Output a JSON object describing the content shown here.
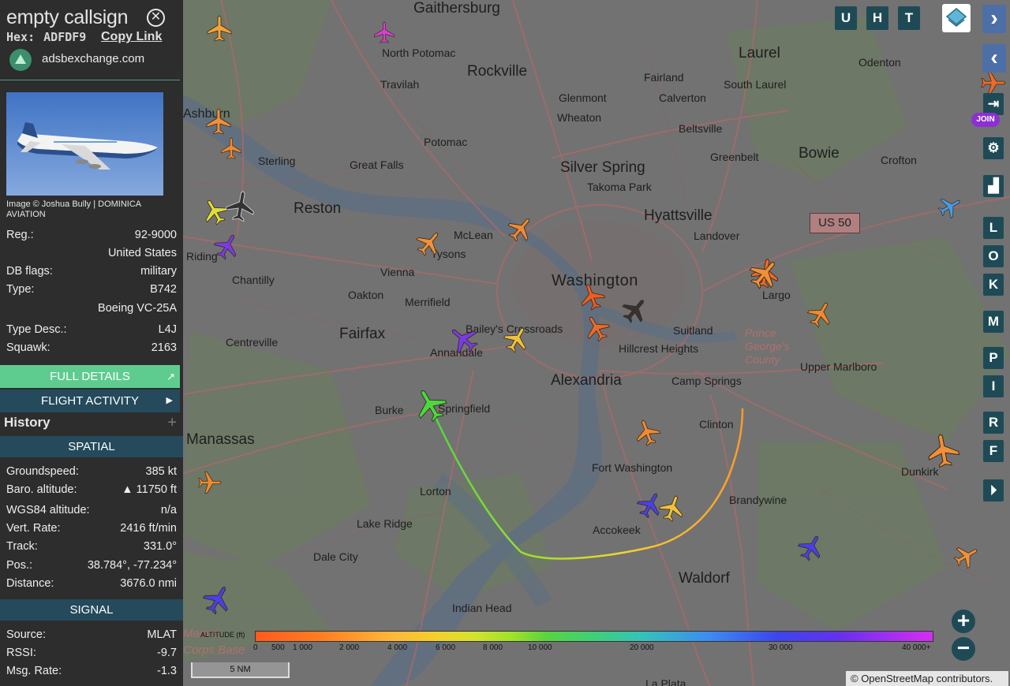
{
  "sidebar": {
    "callsign": "empty callsign",
    "hex_label": "Hex:",
    "hex": "ADFDF9",
    "copy_link": "Copy Link",
    "site": "adsbexchange.com",
    "photo_credit": "Image © Joshua Bully | DOMINICA AVIATION",
    "details": [
      {
        "k": "Reg.:",
        "v": "92-9000"
      },
      {
        "k": "",
        "v": "United States"
      },
      {
        "k": "DB flags:",
        "v": "military"
      },
      {
        "k": "Type:",
        "v": "B742"
      },
      {
        "k": "",
        "v": "Boeing VC-25A"
      },
      {
        "k": "Type Desc.:",
        "v": "L4J"
      },
      {
        "k": "Squawk:",
        "v": "2163"
      }
    ],
    "full_details": "FULL DETAILS",
    "flight_activity": "FLIGHT ACTIVITY",
    "history": "History",
    "spatial_title": "SPATIAL",
    "spatial": [
      {
        "k": "Groundspeed:",
        "v": "385 kt"
      },
      {
        "k": "Baro. altitude:",
        "v": "▲ 11750 ft"
      },
      {
        "k": "WGS84 altitude:",
        "v": "n/a"
      },
      {
        "k": "Vert. Rate:",
        "v": "2416 ft/min"
      },
      {
        "k": "Track:",
        "v": "331.0°"
      },
      {
        "k": "Pos.:",
        "v": "38.784°, -77.234°"
      },
      {
        "k": "Distance:",
        "v": "3676.0 nmi"
      }
    ],
    "signal_title": "SIGNAL",
    "signal": [
      {
        "k": "Source:",
        "v": "MLAT"
      },
      {
        "k": "RSSI:",
        "v": "-9.7"
      },
      {
        "k": "Msg. Rate:",
        "v": "-1.3"
      }
    ]
  },
  "map": {
    "labels": [
      {
        "t": "Gaithersburg",
        "c": "lbl big"
      },
      {
        "t": "North Potomac",
        "c": "lbl sm"
      },
      {
        "t": "Rockville",
        "c": "lbl big"
      },
      {
        "t": "Travilah",
        "c": "lbl sm"
      },
      {
        "t": "Laurel",
        "c": "lbl big"
      },
      {
        "t": "Odenton",
        "c": "lbl sm"
      },
      {
        "t": "Fairland",
        "c": "lbl sm"
      },
      {
        "t": "South Laurel",
        "c": "lbl sm"
      },
      {
        "t": "Glenmont",
        "c": "lbl sm"
      },
      {
        "t": "Calverton",
        "c": "lbl sm"
      },
      {
        "t": "Wheaton",
        "c": "lbl sm"
      },
      {
        "t": "Ashburn",
        "c": "lbl"
      },
      {
        "t": "Beltsville",
        "c": "lbl sm"
      },
      {
        "t": "Potomac",
        "c": "lbl sm"
      },
      {
        "t": "Sterling",
        "c": "lbl sm"
      },
      {
        "t": "Great Falls",
        "c": "lbl sm"
      },
      {
        "t": "Silver Spring",
        "c": "lbl big"
      },
      {
        "t": "Greenbelt",
        "c": "lbl sm"
      },
      {
        "t": "Bowie",
        "c": "lbl big"
      },
      {
        "t": "Crofton",
        "c": "lbl sm"
      },
      {
        "t": "Takoma Park",
        "c": "lbl sm"
      },
      {
        "t": "Reston",
        "c": "lbl big"
      },
      {
        "t": "Hyattsville",
        "c": "lbl big"
      },
      {
        "t": "McLean",
        "c": "lbl sm"
      },
      {
        "t": "Landover",
        "c": "lbl sm"
      },
      {
        "t": "Tysons",
        "c": "lbl sm"
      },
      {
        "t": "Riding",
        "c": "lbl sm"
      },
      {
        "t": "Vienna",
        "c": "lbl sm"
      },
      {
        "t": "Washington",
        "c": "lbl xl"
      },
      {
        "t": "Chantilly",
        "c": "lbl sm"
      },
      {
        "t": "Oakton",
        "c": "lbl sm"
      },
      {
        "t": "Largo",
        "c": "lbl sm"
      },
      {
        "t": "Merrifield",
        "c": "lbl sm"
      },
      {
        "t": "Fairfax",
        "c": "lbl big"
      },
      {
        "t": "Bailey's Crossroads",
        "c": "lbl sm"
      },
      {
        "t": "Suitland",
        "c": "lbl sm"
      },
      {
        "t": "Prince George's County",
        "c": "lbl it"
      },
      {
        "t": "Centreville",
        "c": "lbl sm"
      },
      {
        "t": "Annandale",
        "c": "lbl sm"
      },
      {
        "t": "Hillcrest Heights",
        "c": "lbl sm"
      },
      {
        "t": "Upper Marlboro",
        "c": "lbl sm"
      },
      {
        "t": "Alexandria",
        "c": "lbl big"
      },
      {
        "t": "Camp Springs",
        "c": "lbl sm"
      },
      {
        "t": "Burke",
        "c": "lbl sm"
      },
      {
        "t": "Springfield",
        "c": "lbl sm"
      },
      {
        "t": "Clinton",
        "c": "lbl sm"
      },
      {
        "t": "Manassas",
        "c": "lbl big"
      },
      {
        "t": "Dunkirk",
        "c": "lbl sm"
      },
      {
        "t": "Fort Washington",
        "c": "lbl sm"
      },
      {
        "t": "Lorton",
        "c": "lbl sm"
      },
      {
        "t": "Brandywine",
        "c": "lbl sm"
      },
      {
        "t": "Lake Ridge",
        "c": "lbl sm"
      },
      {
        "t": "Accokeek",
        "c": "lbl sm"
      },
      {
        "t": "Dale City",
        "c": "lbl sm"
      },
      {
        "t": "Waldorf",
        "c": "lbl big"
      },
      {
        "t": "Indian Head",
        "c": "lbl sm"
      },
      {
        "t": "Marine Corps Base",
        "c": "lbl it"
      },
      {
        "t": "La Plata",
        "c": "lbl sm"
      }
    ],
    "route_shield": "US 50",
    "aircraft": [
      {
        "c": "#f2a33a",
        "r": 0
      },
      {
        "c": "#d63fd0",
        "r": 0
      },
      {
        "c": "#f09038",
        "r": 0
      },
      {
        "c": "#f08a32",
        "r": 0
      },
      {
        "c": "#dede3a",
        "r": -30
      },
      {
        "c": "#7a3be6",
        "r": 30
      },
      {
        "c": "#f09038",
        "r": 40
      },
      {
        "c": "#f08a32",
        "r": 40
      },
      {
        "c": "#ee6a2a",
        "r": 10
      },
      {
        "c": "#f08a32",
        "r": 30
      },
      {
        "c": "#ec5d22",
        "r": -20
      },
      {
        "c": "#ee6a2a",
        "r": -30
      },
      {
        "c": "#333333",
        "r": 40
      },
      {
        "c": "#333333",
        "r": 10
      },
      {
        "c": "#7a3be6",
        "r": -50
      },
      {
        "c": "#efc23a",
        "r": 30
      },
      {
        "c": "#52d63f",
        "r": -30
      },
      {
        "c": "#f08a32",
        "r": -20
      },
      {
        "c": "#4a40e6",
        "r": 30
      },
      {
        "c": "#efc23a",
        "r": 20
      },
      {
        "c": "#4a40e6",
        "r": 30
      },
      {
        "c": "#f09038",
        "r": -10
      },
      {
        "c": "#ef8a32",
        "r": 90
      },
      {
        "c": "#ee6a2a",
        "r": 90
      },
      {
        "c": "#4a40e6",
        "r": 30
      },
      {
        "c": "#4a9ae6",
        "r": 60
      },
      {
        "c": "#f09038",
        "r": 40
      },
      {
        "c": "#f09038",
        "r": 60
      }
    ],
    "toolbar_letters": [
      "U",
      "H",
      "T"
    ],
    "side_letters": [
      "L",
      "O",
      "K",
      "M",
      "P",
      "I",
      "R",
      "F"
    ],
    "join": "JOIN",
    "altitude_title": "ALTITUDE (ft)",
    "altitude_ticks": [
      "0",
      "500",
      "1 000",
      "2 000",
      "4 000",
      "6 000",
      "8 000",
      "10 000",
      "20 000",
      "30 000",
      "40 000+"
    ],
    "scale": "5 NM",
    "attribution": "© OpenStreetMap contributors."
  }
}
